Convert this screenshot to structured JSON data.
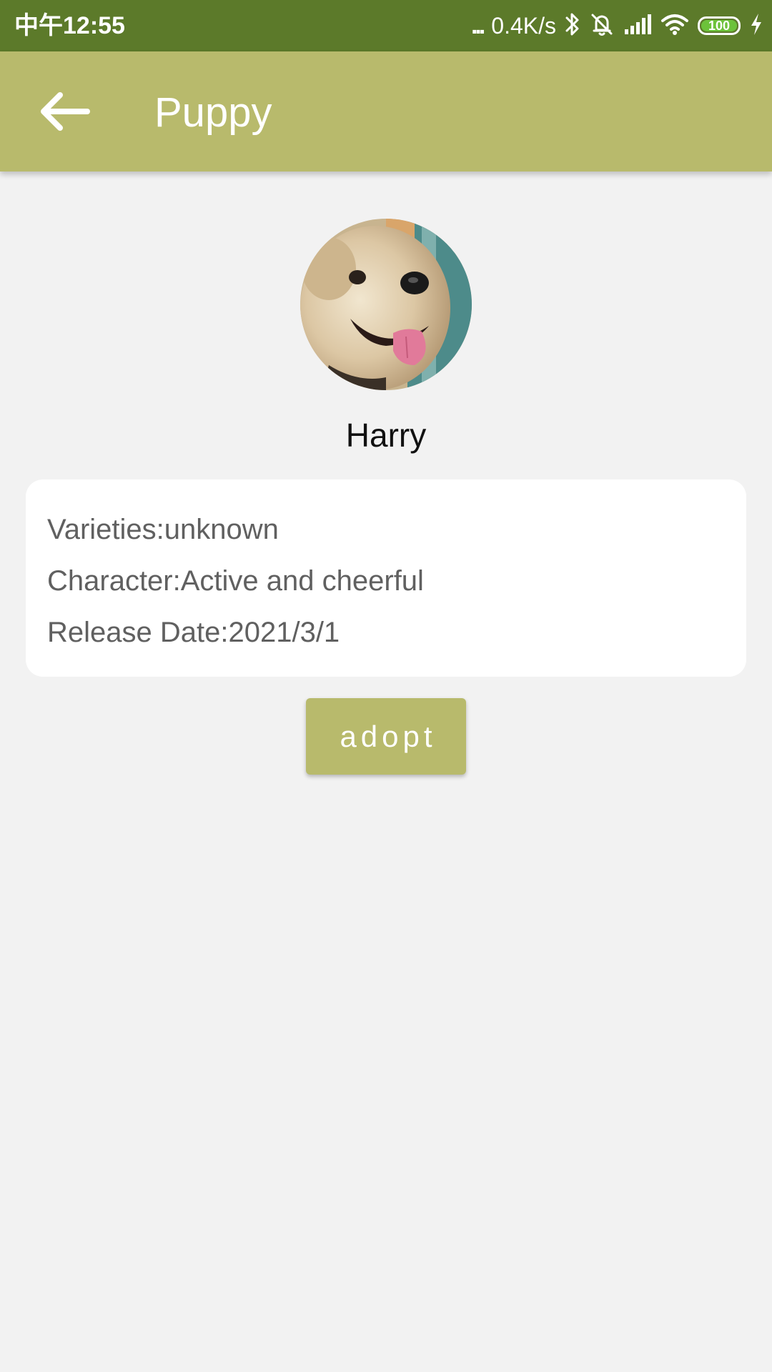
{
  "status_bar": {
    "time": "中午12:55",
    "dots": "...",
    "net_speed": "0.4K/s",
    "battery_level": "100",
    "icons": [
      "bluetooth-icon",
      "mute-bell-icon",
      "cellular-signal-icon",
      "wifi-icon",
      "battery-icon",
      "charging-icon"
    ]
  },
  "app_bar": {
    "title": "Puppy",
    "back_icon": "arrow-left-icon"
  },
  "pet": {
    "name": "Harry",
    "avatar_alt": "dog-photo",
    "info": {
      "varieties": "Varieties:unknown",
      "character": "Character:Active and cheerful",
      "release_date": "Release Date:2021/3/1"
    }
  },
  "actions": {
    "adopt_label": "adopt"
  },
  "colors": {
    "status_bar": "#5c7a2a",
    "app_bar": "#b8ba6c",
    "background": "#f2f2f2",
    "card": "#ffffff",
    "battery_fill": "#6cc23a"
  }
}
